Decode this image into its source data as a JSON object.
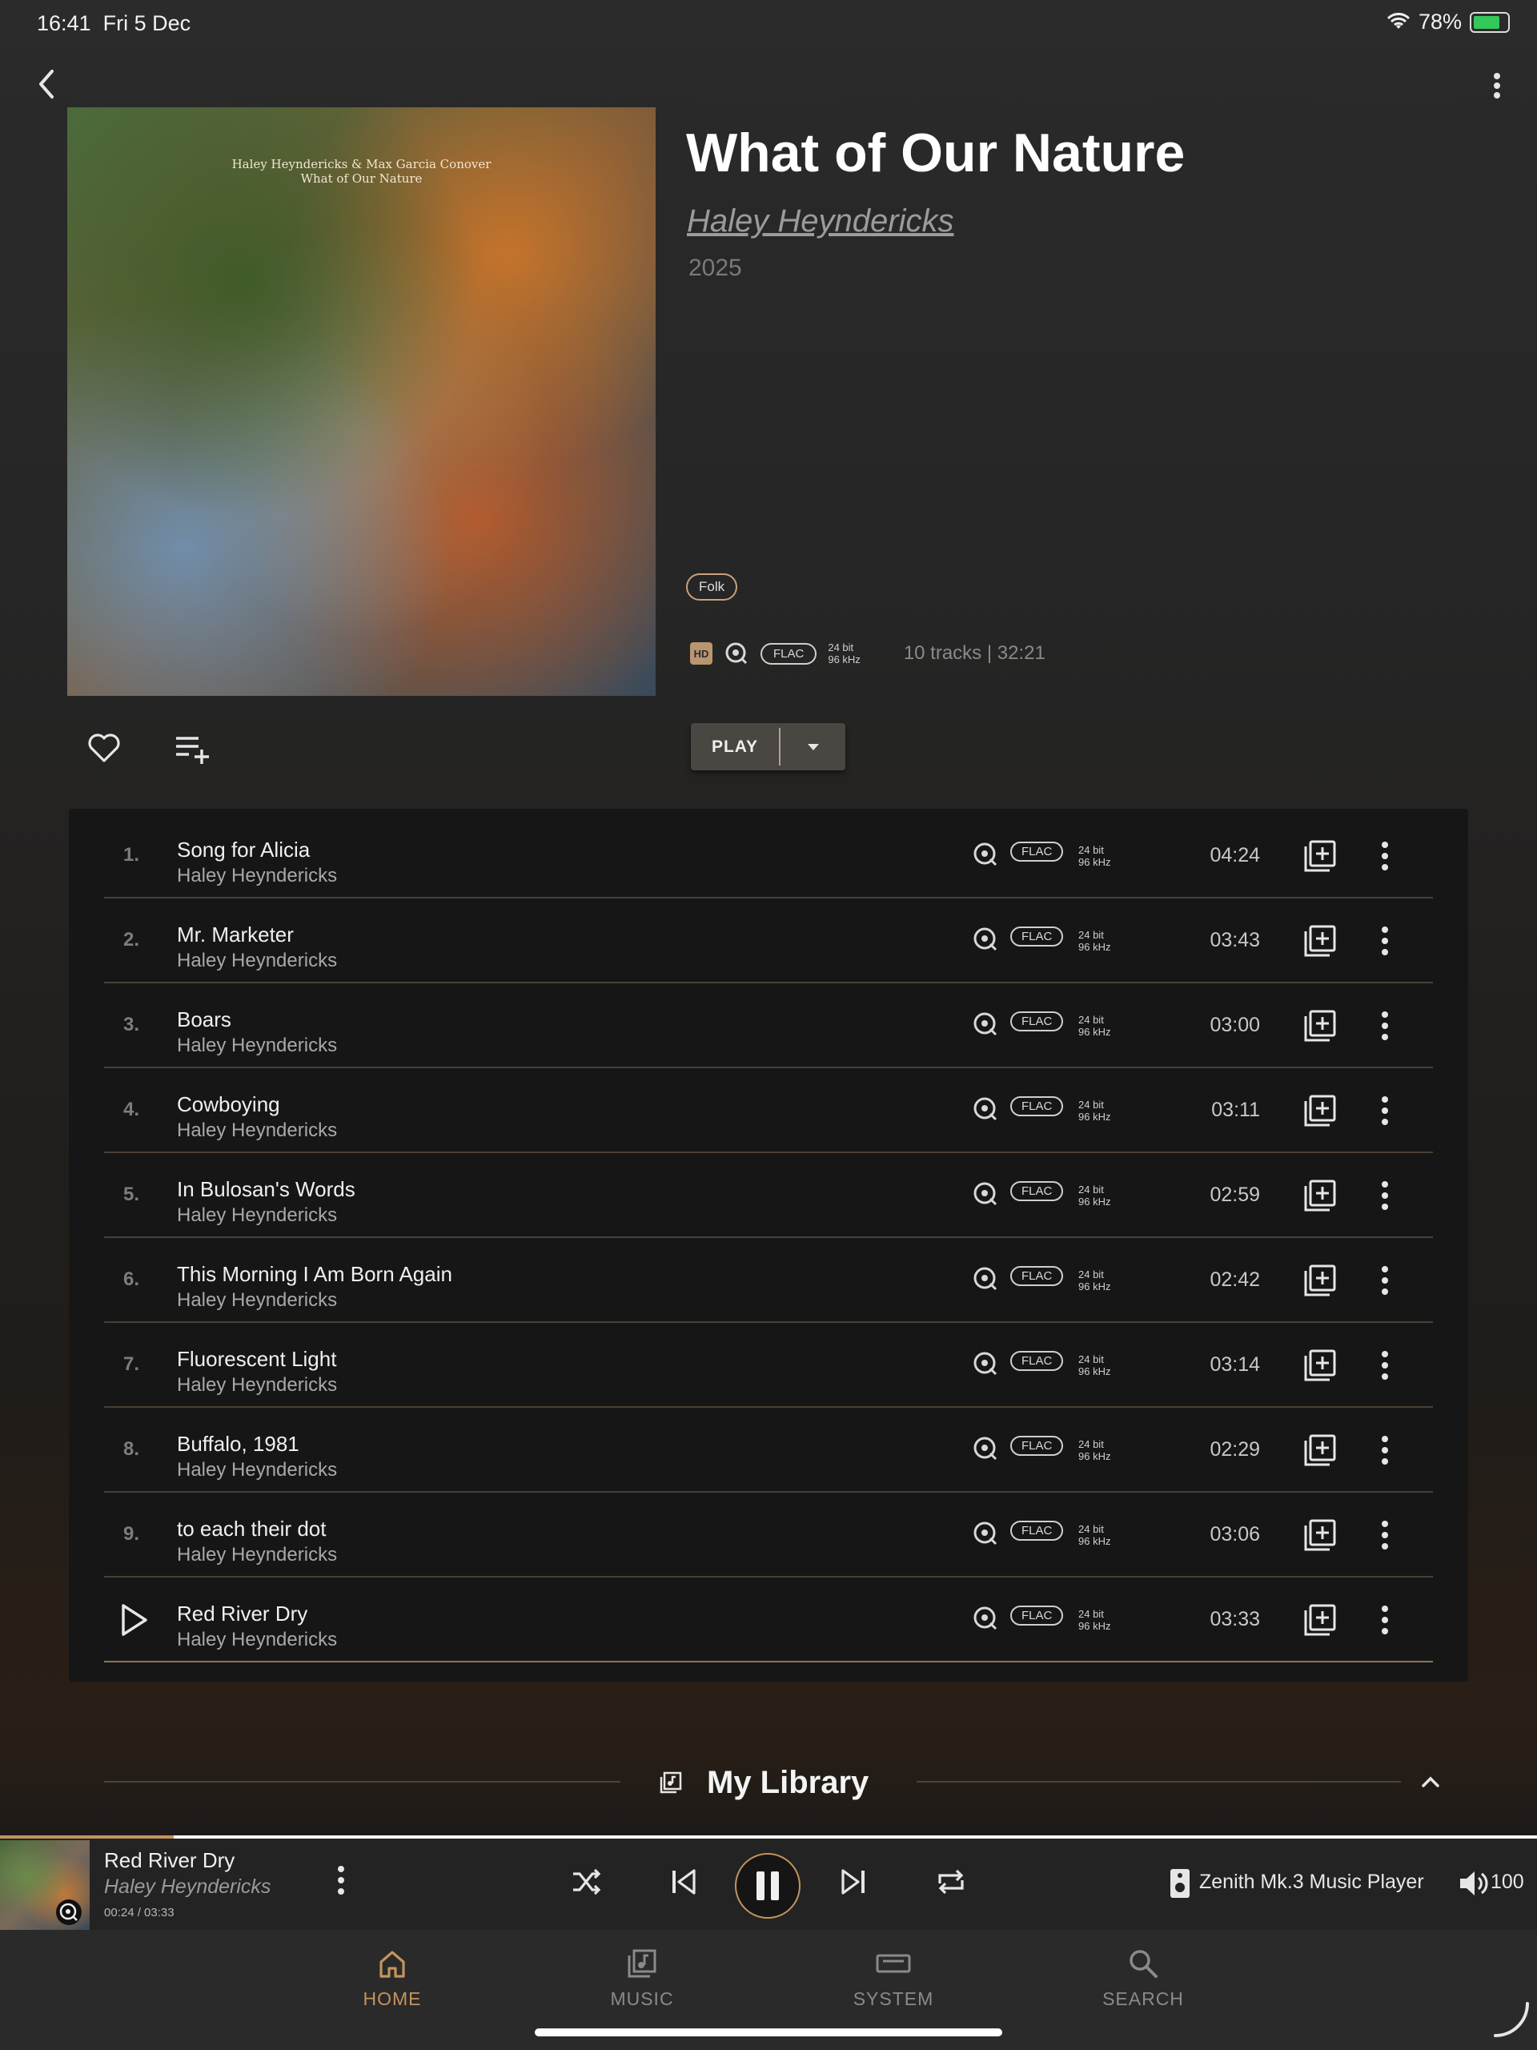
{
  "status_bar": {
    "time": "16:41",
    "date": "Fri 5 Dec",
    "battery": "78%"
  },
  "album": {
    "title": "What of Our Nature",
    "artist": "Haley Heyndericks",
    "year": "2025",
    "cover_caption_line1": "Haley Heyndericks & Max Garcia Conover",
    "cover_caption_line2": "What of Our Nature",
    "genre": "Folk",
    "hd_badge": "HD",
    "format": "FLAC",
    "bit_depth": "24 bit",
    "sample_rate": "96 kHz",
    "summary": "10 tracks | 32:21"
  },
  "play_button": {
    "label": "PLAY"
  },
  "tracks": [
    {
      "num": "1.",
      "title": "Song for Alicia",
      "artist": "Haley Heyndericks",
      "format": "FLAC",
      "bit": "24 bit",
      "rate": "96 kHz",
      "duration": "04:24"
    },
    {
      "num": "2.",
      "title": "Mr. Marketer",
      "artist": "Haley Heyndericks",
      "format": "FLAC",
      "bit": "24 bit",
      "rate": "96 kHz",
      "duration": "03:43"
    },
    {
      "num": "3.",
      "title": "Boars",
      "artist": "Haley Heyndericks",
      "format": "FLAC",
      "bit": "24 bit",
      "rate": "96 kHz",
      "duration": "03:00"
    },
    {
      "num": "4.",
      "title": "Cowboying",
      "artist": "Haley Heyndericks",
      "format": "FLAC",
      "bit": "24 bit",
      "rate": "96 kHz",
      "duration": "03:11"
    },
    {
      "num": "5.",
      "title": "In Bulosan's Words",
      "artist": "Haley Heyndericks",
      "format": "FLAC",
      "bit": "24 bit",
      "rate": "96 kHz",
      "duration": "02:59"
    },
    {
      "num": "6.",
      "title": "This Morning I Am Born Again",
      "artist": "Haley Heyndericks",
      "format": "FLAC",
      "bit": "24 bit",
      "rate": "96 kHz",
      "duration": "02:42"
    },
    {
      "num": "7.",
      "title": "Fluorescent Light",
      "artist": "Haley Heyndericks",
      "format": "FLAC",
      "bit": "24 bit",
      "rate": "96 kHz",
      "duration": "03:14"
    },
    {
      "num": "8.",
      "title": "Buffalo, 1981",
      "artist": "Haley Heyndericks",
      "format": "FLAC",
      "bit": "24 bit",
      "rate": "96 kHz",
      "duration": "02:29"
    },
    {
      "num": "9.",
      "title": "to each their dot",
      "artist": "Haley Heyndericks",
      "format": "FLAC",
      "bit": "24 bit",
      "rate": "96 kHz",
      "duration": "03:06"
    },
    {
      "num": "",
      "title": "Red River Dry",
      "artist": "Haley Heyndericks",
      "format": "FLAC",
      "bit": "24 bit",
      "rate": "96 kHz",
      "duration": "03:33",
      "playing": true
    }
  ],
  "library": {
    "title": "My Library"
  },
  "now_playing": {
    "title": "Red River Dry",
    "artist": "Haley Heyndericks",
    "time": "00:24 / 03:33",
    "progress": 0.113,
    "device": "Zenith Mk.3 Music Player",
    "volume": "100"
  },
  "tabs": [
    {
      "label": "HOME",
      "icon": "home-icon",
      "active": true
    },
    {
      "label": "MUSIC",
      "icon": "music-icon",
      "active": false
    },
    {
      "label": "SYSTEM",
      "icon": "system-icon",
      "active": false
    },
    {
      "label": "SEARCH",
      "icon": "search-icon",
      "active": false
    }
  ],
  "colors": {
    "accent": "#c4935f",
    "background": "#262626",
    "tracklist_bg": "#161616"
  }
}
